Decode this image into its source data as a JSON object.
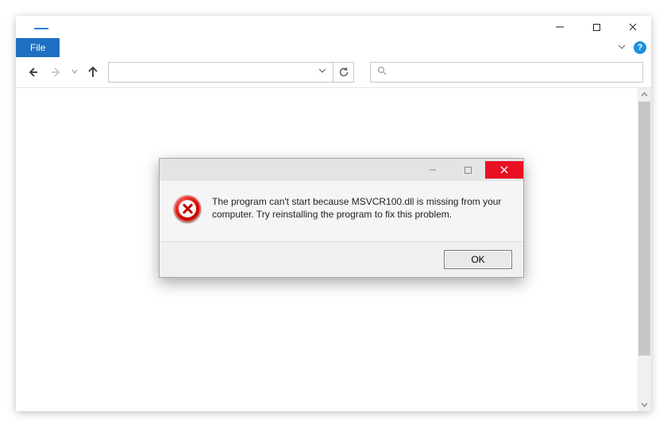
{
  "ribbon": {
    "file_label": "File"
  },
  "dialog": {
    "message": "The program can't start because MSVCR100.dll is missing from your computer. Try reinstalling the program to fix this problem.",
    "ok_label": "OK"
  }
}
